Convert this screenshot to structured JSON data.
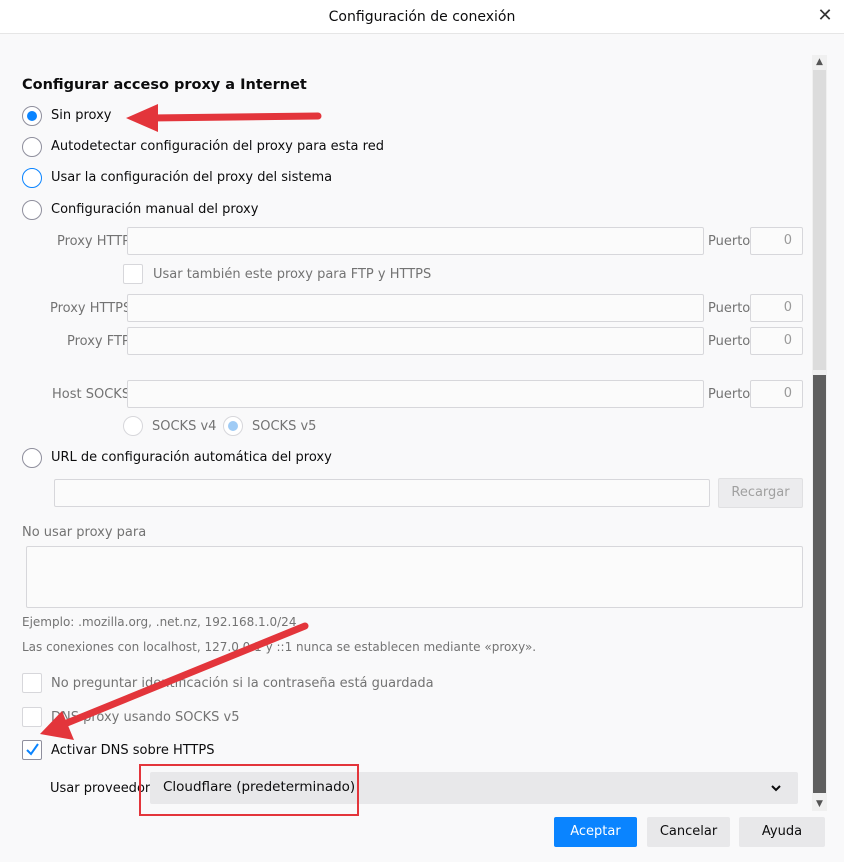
{
  "window": {
    "title": "Configuración de conexión",
    "close_glyph": "✕"
  },
  "section": {
    "heading": "Configurar acceso proxy a Internet"
  },
  "proxy_options": {
    "none": "Sin proxy",
    "auto_detect": "Autodetectar configuración del proxy para esta red",
    "system": "Usar la configuración del proxy del sistema",
    "manual": "Configuración manual del proxy",
    "pac_url": "URL de configuración automática del proxy"
  },
  "manual": {
    "http_label": "Proxy HTTP",
    "port_label": "Puerto",
    "http_port": "0",
    "also_use_label": "Usar también este proxy para FTP y HTTPS",
    "https_label": "Proxy HTTPS",
    "https_port": "0",
    "ftp_label": "Proxy FTP",
    "ftp_port": "0",
    "socks_label": "Host SOCKS",
    "socks_port": "0",
    "socks_v4": "SOCKS v4",
    "socks_v5": "SOCKS v5"
  },
  "pac": {
    "reload_label": "Recargar"
  },
  "no_proxy": {
    "label": "No usar proxy para",
    "example": "Ejemplo: .mozilla.org, .net.nz, 192.168.1.0/24",
    "localhost_note": "Las conexiones con localhost, 127.0.0.1 y ::1 nunca se establecen mediante «proxy»."
  },
  "options": {
    "no_auth_prompt": "No preguntar identificación si la contraseña está guardada",
    "socks_dns": "DNS proxy usando SOCKS v5",
    "doh": "Activar DNS sobre HTTPS"
  },
  "provider": {
    "label": "Usar proveedor",
    "selected": "Cloudflare (predeterminado)"
  },
  "buttons": {
    "accept": "Aceptar",
    "cancel": "Cancelar",
    "help": "Ayuda"
  },
  "colors": {
    "accent": "#0a84ff",
    "annotation": "#e3353b"
  }
}
